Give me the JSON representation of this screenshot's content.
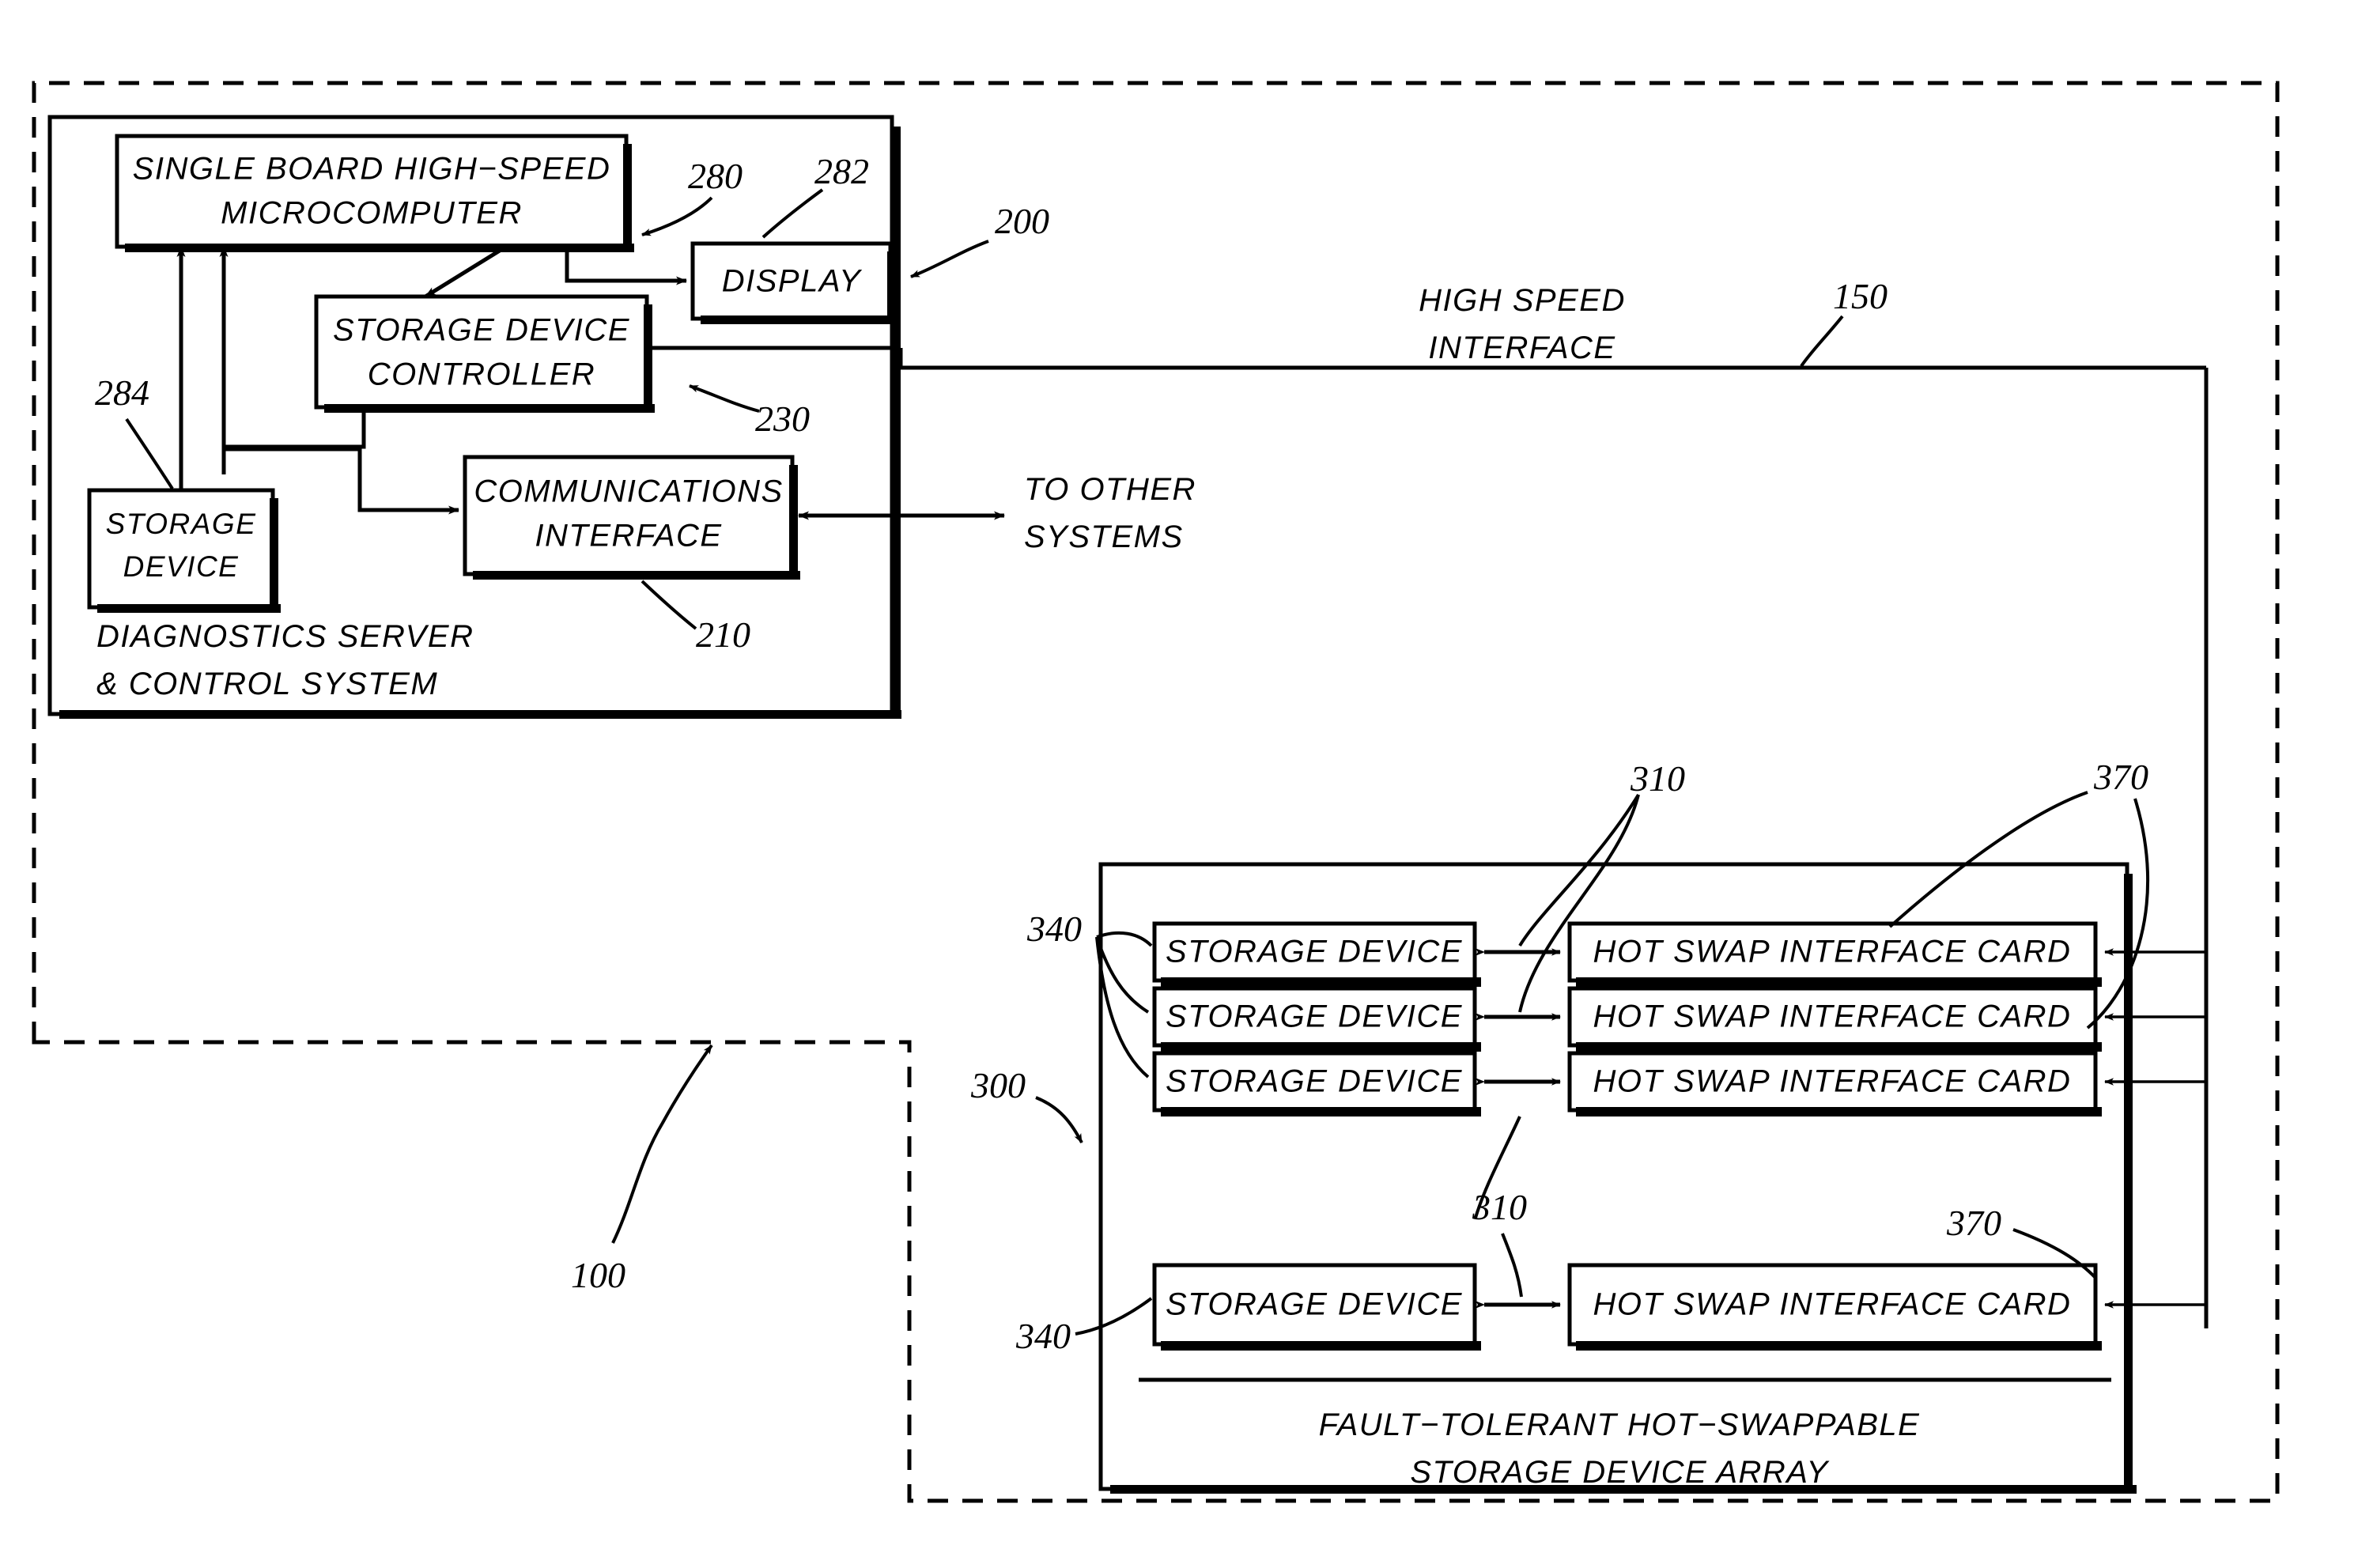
{
  "figure": {
    "title": "System block diagram",
    "ink_color": "#000000",
    "paper_color": "#ffffff"
  },
  "boundary": {
    "name": "system-boundary",
    "style": "dash-dot"
  },
  "server": {
    "caption_line1": "DIAGNOSTICS SERVER",
    "caption_line2": "& CONTROL SYSTEM",
    "ref": "200",
    "blocks": [
      {
        "id": "microcomputer",
        "line1": "SINGLE BOARD HIGH−SPEED",
        "line2": "MICROCOMPUTER",
        "ref": "280"
      },
      {
        "id": "display",
        "line1": "DISPLAY",
        "line2": "",
        "ref": "282"
      },
      {
        "id": "storage-device-controller",
        "line1": "STORAGE  DEVICE",
        "line2": "CONTROLLER",
        "ref": "230"
      },
      {
        "id": "communications-interface",
        "line1": "COMMUNICATIONS",
        "line2": "INTERFACE",
        "ref": "210"
      },
      {
        "id": "server-storage-device",
        "line1": "STORAGE",
        "line2": "DEVICE",
        "ref": "284"
      }
    ]
  },
  "bus": {
    "label_line1": "HIGH SPEED",
    "label_line2": "INTERFACE",
    "ref": "150"
  },
  "external": {
    "to_other_systems_line1": "TO OTHER",
    "to_other_systems_line2": "SYSTEMS"
  },
  "array": {
    "caption_line1": "FAULT−TOLERANT HOT−SWAPPABLE",
    "caption_line2": "STORAGE DEVICE ARRAY",
    "ref": "300",
    "storage_device_label": "STORAGE  DEVICE",
    "hot_swap_label": "HOT  SWAP  INTERFACE  CARD",
    "storage_device_ref": "340",
    "link_ref": "310",
    "hot_swap_ref": "370",
    "rows": [
      {
        "storage": "STORAGE  DEVICE",
        "card": "HOT  SWAP  INTERFACE  CARD"
      },
      {
        "storage": "STORAGE  DEVICE",
        "card": "HOT  SWAP  INTERFACE  CARD"
      },
      {
        "storage": "STORAGE  DEVICE",
        "card": "HOT  SWAP  INTERFACE  CARD"
      },
      {
        "storage": "STORAGE  DEVICE",
        "card": "HOT  SWAP  INTERFACE  CARD"
      }
    ]
  },
  "refs": {
    "system": "100",
    "server": "200",
    "bus": "150",
    "comm": "210",
    "sdc": "230",
    "micro": "280",
    "display": "282",
    "server_storage": "284",
    "array": "300",
    "link_top": "310",
    "link_bottom": "310",
    "storage_top": "340",
    "storage_bottom": "340",
    "card_top": "370",
    "card_bottom": "370"
  }
}
